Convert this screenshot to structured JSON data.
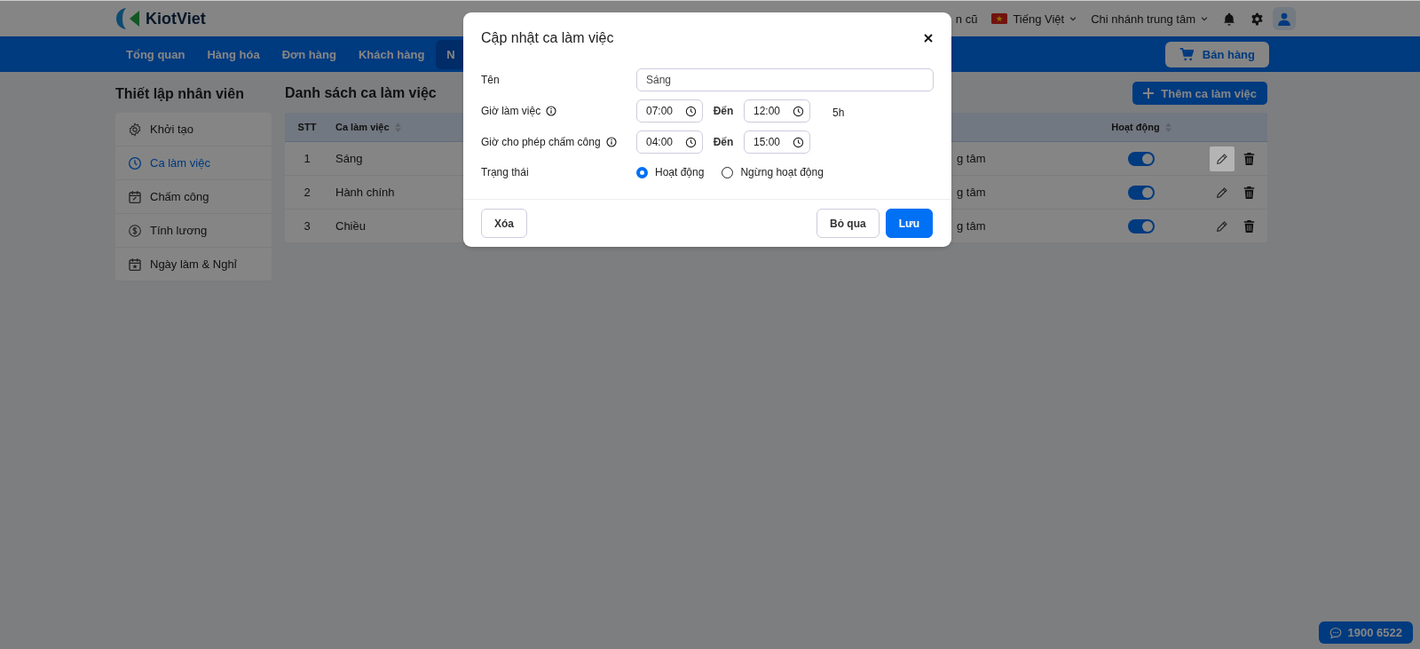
{
  "header": {
    "logo": "KiotViet",
    "partial_link": "n cũ",
    "language": "Tiếng Việt",
    "branch": "Chi nhánh trung tâm"
  },
  "nav": {
    "items": [
      {
        "label": "Tổng quan",
        "selected": false
      },
      {
        "label": "Hàng hóa",
        "selected": false
      },
      {
        "label": "Đơn hàng",
        "selected": false
      },
      {
        "label": "Khách hàng",
        "selected": false
      },
      {
        "label": "N",
        "selected": true
      }
    ],
    "sell_button": "Bán hàng"
  },
  "sidebar": {
    "title": "Thiết lập nhân viên",
    "items": [
      {
        "label": "Khởi tạo",
        "kind": "gear",
        "selected": false
      },
      {
        "label": "Ca làm việc",
        "kind": "clock",
        "selected": true
      },
      {
        "label": "Chấm công",
        "kind": "calendar",
        "selected": false
      },
      {
        "label": "Tính lương",
        "kind": "money",
        "selected": false
      },
      {
        "label": "Ngày làm & Nghỉ",
        "kind": "holiday",
        "selected": false
      }
    ]
  },
  "main": {
    "title": "Danh sách ca làm việc",
    "add_button": "Thêm ca làm việc",
    "columns": [
      "STT",
      "Ca làm việc",
      "Hoạt động"
    ],
    "rows": [
      {
        "index": "1",
        "name": "Sáng",
        "branch": "g tâm",
        "active": true,
        "edit_hovered": true
      },
      {
        "index": "2",
        "name": "Hành chính",
        "branch": "g tâm",
        "active": true,
        "edit_hovered": false
      },
      {
        "index": "3",
        "name": "Chiều",
        "branch": "g tâm",
        "active": true,
        "edit_hovered": false
      }
    ]
  },
  "modal": {
    "title": "Cập nhật ca làm việc",
    "name_label": "Tên",
    "name_value": "Sáng",
    "time_rows": [
      {
        "label": "Giờ làm việc",
        "from": "07:00",
        "to_label": "Đến",
        "to": "12:00",
        "duration": "5h"
      },
      {
        "label": "Giờ cho phép chấm công",
        "from": "04:00",
        "to_label": "Đến",
        "to": "15:00"
      }
    ],
    "status_label": "Trạng thái",
    "status_options": [
      {
        "label": "Hoạt động",
        "selected": true
      },
      {
        "label": "Ngừng hoạt động",
        "selected": false
      }
    ],
    "delete_button": "Xóa",
    "cancel_button": "Bỏ qua",
    "save_button": "Lưu"
  },
  "hotline": "1900 6522"
}
